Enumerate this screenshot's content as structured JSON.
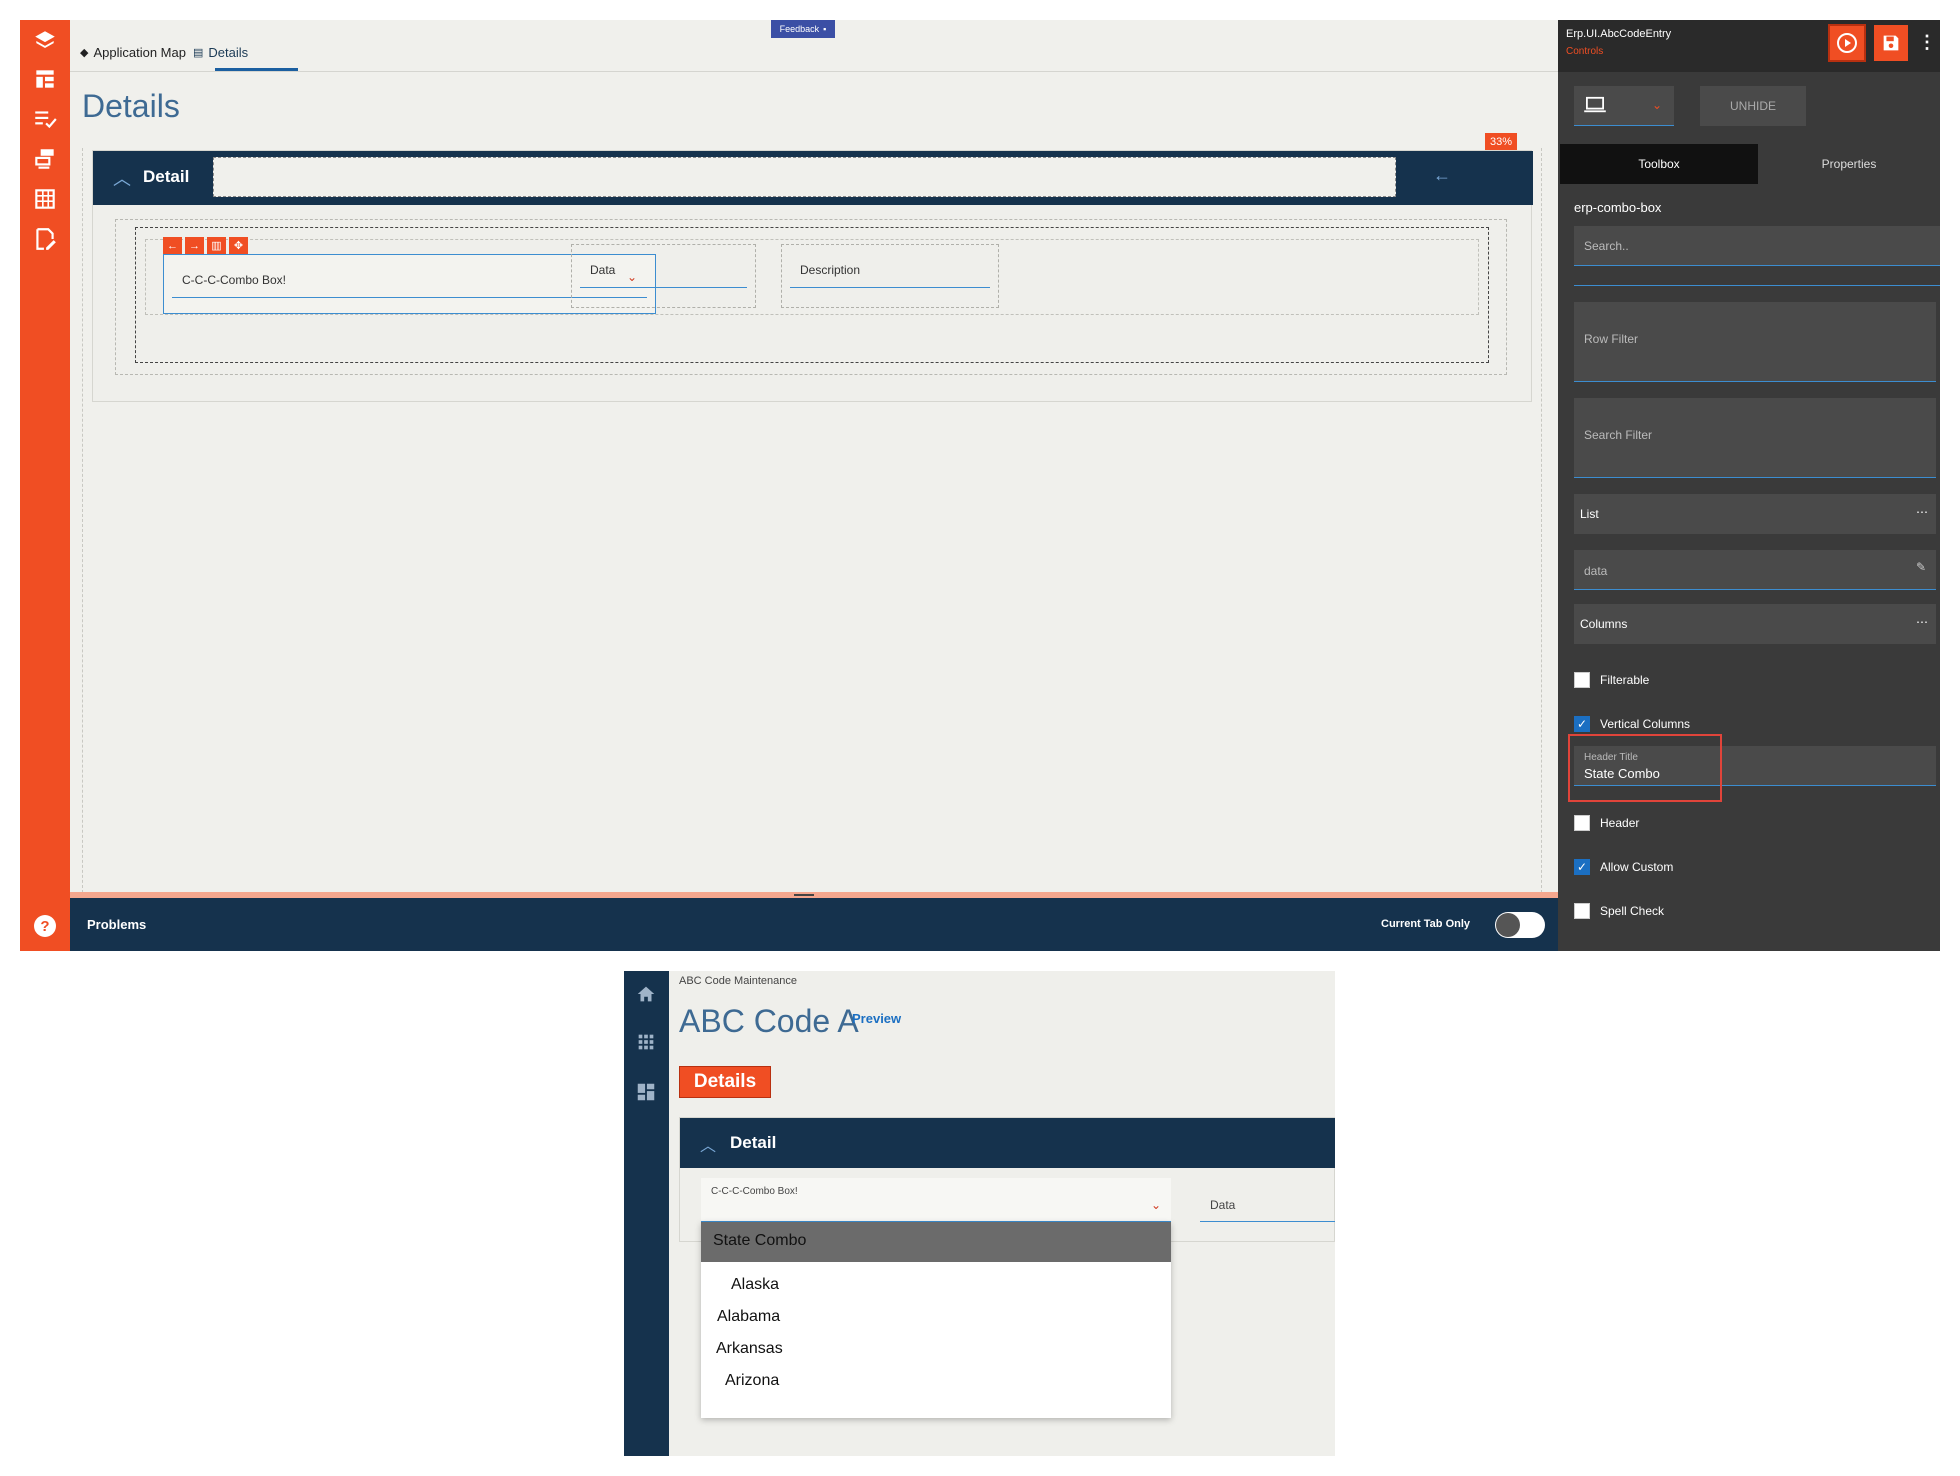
{
  "designer": {
    "tabs": [
      {
        "label": "Application Map"
      },
      {
        "label": "Details"
      }
    ],
    "feedback_label": "Feedback",
    "page_title": "Details",
    "zoom_badge": "33%",
    "detail_label": "Detail",
    "fields": {
      "combo": "C-C-C-Combo Box!",
      "data": "Data",
      "description": "Description"
    },
    "problems_label": "Problems",
    "current_tab_only_label": "Current Tab Only",
    "accent_color": "#f04e23",
    "header_color": "#15324d"
  },
  "right_panel": {
    "title": "Erp.UI.AbcCodeEntry",
    "subtitle": "Controls",
    "unhide_label": "UNHIDE",
    "tabs": {
      "toolbox": "Toolbox",
      "properties": "Properties"
    },
    "component_name": "erp-combo-box",
    "search_placeholder": "Search..",
    "row_filter_label": "Row Filter",
    "search_filter_label": "Search Filter",
    "list_label": "List",
    "list_value": "data",
    "columns_label": "Columns",
    "checks": [
      {
        "label": "Filterable",
        "checked": false
      },
      {
        "label": "Vertical Columns",
        "checked": true
      },
      {
        "label": "Header",
        "checked": false
      },
      {
        "label": "Allow Custom",
        "checked": true
      },
      {
        "label": "Spell Check",
        "checked": false
      }
    ],
    "header_title_label": "Header Title",
    "header_title_value": "State Combo"
  },
  "preview": {
    "breadcrumb": "ABC Code Maintenance",
    "title": "ABC Code A",
    "preview_link": "Preview",
    "details_tab": "Details",
    "detail_label": "Detail",
    "combo_label": "C-C-C-Combo Box!",
    "data_label": "Data",
    "dropdown_header": "State Combo",
    "dropdown_items": [
      "Alaska",
      "Alabama",
      "Arkansas",
      "Arizona"
    ]
  }
}
